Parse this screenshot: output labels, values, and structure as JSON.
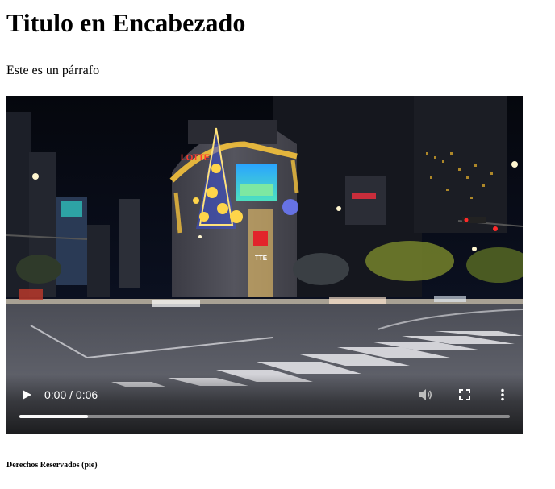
{
  "heading": "Titulo en Encabezado",
  "paragraph": "Este es un párrafo",
  "video": {
    "time": "0:00 / 0:06",
    "buffered_fraction": 0.14,
    "scene_text": {
      "lotte": "LOTTE",
      "tte": "TTE"
    },
    "icons": {
      "play": "play-icon",
      "volume": "volume-icon",
      "fullscreen": "fullscreen-icon",
      "more": "more-vert-icon"
    }
  },
  "footer": "Derechos Reservados (pie)"
}
